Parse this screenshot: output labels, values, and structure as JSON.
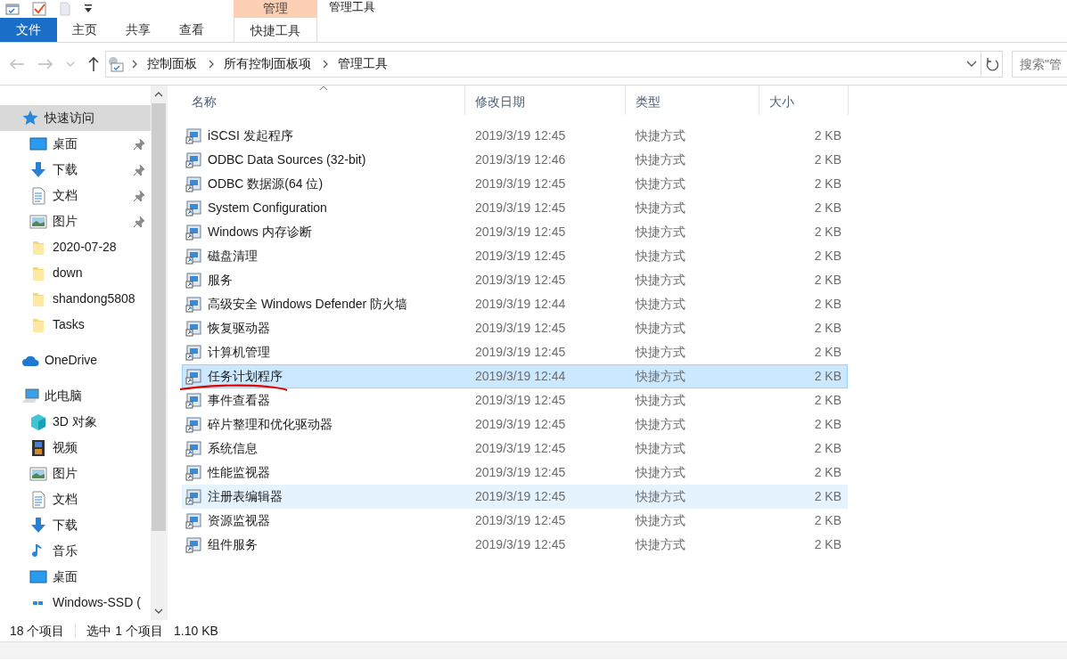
{
  "window": {
    "title": "管理工具"
  },
  "ribbon": {
    "context_group": "管理",
    "tabs": [
      {
        "label": "文件",
        "kind": "file"
      },
      {
        "label": "主页",
        "kind": "tab"
      },
      {
        "label": "共享",
        "kind": "tab"
      },
      {
        "label": "查看",
        "kind": "tab"
      },
      {
        "label": "快捷工具",
        "kind": "context"
      }
    ]
  },
  "address": {
    "path": [
      "控制面板",
      "所有控制面板项",
      "管理工具"
    ],
    "search_placeholder": "搜索\"管"
  },
  "sidebar": {
    "items": [
      {
        "label": "快速访问",
        "kind": "star",
        "selected": true,
        "children": [
          {
            "label": "桌面",
            "kind": "desktop",
            "selected": false,
            "pinned": true
          },
          {
            "label": "下载",
            "kind": "download",
            "selected": false,
            "pinned": true
          },
          {
            "label": "文档",
            "kind": "document",
            "selected": false,
            "pinned": true
          },
          {
            "label": "图片",
            "kind": "pictures",
            "selected": false,
            "pinned": true
          },
          {
            "label": "2020-07-28",
            "kind": "folder",
            "selected": false,
            "pinned": false
          },
          {
            "label": "down",
            "kind": "folder",
            "selected": false,
            "pinned": false
          },
          {
            "label": "shandong5808",
            "kind": "folder",
            "selected": false,
            "pinned": false
          },
          {
            "label": "Tasks",
            "kind": "folder",
            "selected": false,
            "pinned": false
          }
        ]
      },
      {
        "label": "OneDrive",
        "kind": "cloud",
        "selected": false
      },
      {
        "label": "此电脑",
        "kind": "computer",
        "selected": false,
        "children": [
          {
            "label": "3D 对象",
            "kind": "cube",
            "selected": false,
            "pinned": false
          },
          {
            "label": "视频",
            "kind": "video",
            "selected": false,
            "pinned": false
          },
          {
            "label": "图片",
            "kind": "pictures",
            "selected": false,
            "pinned": false
          },
          {
            "label": "文档",
            "kind": "document",
            "selected": false,
            "pinned": false
          },
          {
            "label": "下载",
            "kind": "download",
            "selected": false,
            "pinned": false
          },
          {
            "label": "音乐",
            "kind": "music",
            "selected": false,
            "pinned": false
          },
          {
            "label": "桌面",
            "kind": "desktop",
            "selected": false,
            "pinned": false
          },
          {
            "label": "Windows-SSD (",
            "kind": "drive",
            "selected": false,
            "pinned": false
          }
        ]
      }
    ]
  },
  "table": {
    "columns": [
      {
        "label": "名称",
        "sorted": true
      },
      {
        "label": "修改日期",
        "sorted": false
      },
      {
        "label": "类型",
        "sorted": false
      },
      {
        "label": "大小",
        "sorted": false
      }
    ],
    "rows": [
      {
        "name": "iSCSI 发起程序",
        "date": "2019/3/19 12:45",
        "type": "快捷方式",
        "size": "2 KB",
        "selected": false,
        "hovered": false,
        "annotated": false
      },
      {
        "name": "ODBC Data Sources (32-bit)",
        "date": "2019/3/19 12:46",
        "type": "快捷方式",
        "size": "2 KB",
        "selected": false,
        "hovered": false,
        "annotated": false
      },
      {
        "name": "ODBC 数据源(64 位)",
        "date": "2019/3/19 12:45",
        "type": "快捷方式",
        "size": "2 KB",
        "selected": false,
        "hovered": false,
        "annotated": false
      },
      {
        "name": "System Configuration",
        "date": "2019/3/19 12:45",
        "type": "快捷方式",
        "size": "2 KB",
        "selected": false,
        "hovered": false,
        "annotated": false
      },
      {
        "name": "Windows 内存诊断",
        "date": "2019/3/19 12:45",
        "type": "快捷方式",
        "size": "2 KB",
        "selected": false,
        "hovered": false,
        "annotated": false
      },
      {
        "name": "磁盘清理",
        "date": "2019/3/19 12:45",
        "type": "快捷方式",
        "size": "2 KB",
        "selected": false,
        "hovered": false,
        "annotated": false
      },
      {
        "name": "服务",
        "date": "2019/3/19 12:45",
        "type": "快捷方式",
        "size": "2 KB",
        "selected": false,
        "hovered": false,
        "annotated": false
      },
      {
        "name": "高级安全 Windows Defender 防火墙",
        "date": "2019/3/19 12:44",
        "type": "快捷方式",
        "size": "2 KB",
        "selected": false,
        "hovered": false,
        "annotated": false
      },
      {
        "name": "恢复驱动器",
        "date": "2019/3/19 12:45",
        "type": "快捷方式",
        "size": "2 KB",
        "selected": false,
        "hovered": false,
        "annotated": false
      },
      {
        "name": "计算机管理",
        "date": "2019/3/19 12:45",
        "type": "快捷方式",
        "size": "2 KB",
        "selected": false,
        "hovered": false,
        "annotated": false
      },
      {
        "name": "任务计划程序",
        "date": "2019/3/19 12:44",
        "type": "快捷方式",
        "size": "2 KB",
        "selected": true,
        "hovered": false,
        "annotated": true
      },
      {
        "name": "事件查看器",
        "date": "2019/3/19 12:45",
        "type": "快捷方式",
        "size": "2 KB",
        "selected": false,
        "hovered": false,
        "annotated": false
      },
      {
        "name": "碎片整理和优化驱动器",
        "date": "2019/3/19 12:45",
        "type": "快捷方式",
        "size": "2 KB",
        "selected": false,
        "hovered": false,
        "annotated": false
      },
      {
        "name": "系统信息",
        "date": "2019/3/19 12:45",
        "type": "快捷方式",
        "size": "2 KB",
        "selected": false,
        "hovered": false,
        "annotated": false
      },
      {
        "name": "性能监视器",
        "date": "2019/3/19 12:45",
        "type": "快捷方式",
        "size": "2 KB",
        "selected": false,
        "hovered": false,
        "annotated": false
      },
      {
        "name": "注册表编辑器",
        "date": "2019/3/19 12:45",
        "type": "快捷方式",
        "size": "2 KB",
        "selected": false,
        "hovered": true,
        "annotated": false
      },
      {
        "name": "资源监视器",
        "date": "2019/3/19 12:45",
        "type": "快捷方式",
        "size": "2 KB",
        "selected": false,
        "hovered": false,
        "annotated": false
      },
      {
        "name": "组件服务",
        "date": "2019/3/19 12:45",
        "type": "快捷方式",
        "size": "2 KB",
        "selected": false,
        "hovered": false,
        "annotated": false
      }
    ]
  },
  "status_bar": {
    "count": "18 个项目",
    "selection": "选中 1 个项目",
    "size": "1.10 KB"
  }
}
